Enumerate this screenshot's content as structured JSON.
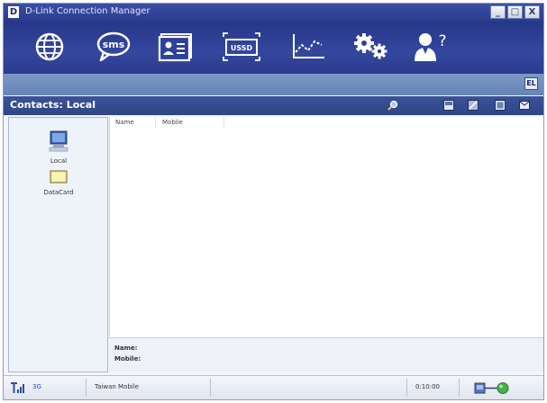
{
  "window": {
    "app_icon_letter": "D",
    "title": "D-Link Connection Manager",
    "minimize_glyph": "_",
    "maximize_glyph": "□",
    "close_glyph": "X"
  },
  "toolbar": {
    "items": [
      {
        "name": "internet",
        "icon": "globe-icon"
      },
      {
        "name": "sms",
        "icon": "sms-bubble-icon",
        "label": "sms"
      },
      {
        "name": "contacts",
        "icon": "contact-card-icon"
      },
      {
        "name": "ussd",
        "icon": "ussd-icon",
        "label": "USSD"
      },
      {
        "name": "statistics",
        "icon": "line-chart-icon"
      },
      {
        "name": "settings",
        "icon": "gears-icon"
      },
      {
        "name": "help",
        "icon": "help-person-icon",
        "label": "?"
      }
    ]
  },
  "strip": {
    "toggle_label": "EL"
  },
  "header": {
    "title": "Contacts: Local",
    "icons": [
      "search-icon",
      "new-contact-icon",
      "edit-contact-icon",
      "delete-contact-icon",
      "message-icon"
    ]
  },
  "folders": [
    {
      "label": "Local",
      "icon": "computer-icon",
      "selected": true
    },
    {
      "label": "DataCard",
      "icon": "datacard-icon",
      "selected": false
    }
  ],
  "table": {
    "columns": [
      "Name",
      "Mobile"
    ],
    "rows": []
  },
  "detail": {
    "name_label": "Name:",
    "mobile_label": "Mobile:"
  },
  "status": {
    "network_type": "3G",
    "operator": "Taiwan Mobile",
    "timer": "0:10:00"
  },
  "colors": {
    "toolbar": "#2e409a",
    "header": "#34498c",
    "strip": "#7390c0"
  }
}
